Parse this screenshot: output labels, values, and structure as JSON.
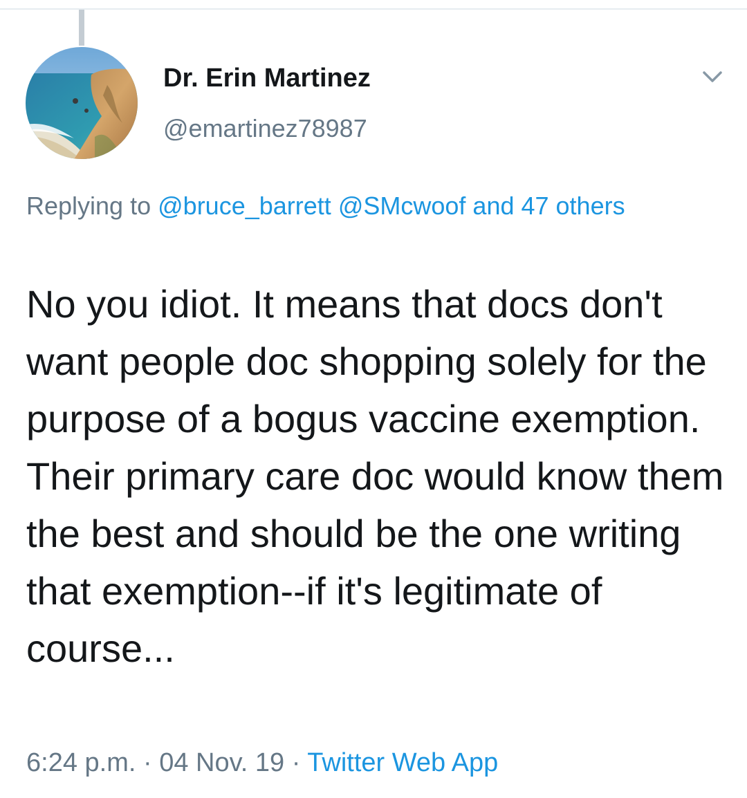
{
  "tweet": {
    "author": {
      "display_name": "Dr. Erin Martinez",
      "handle": "@emartinez78987",
      "avatar_icon": "beach-coast-avatar"
    },
    "menu_icon": "chevron-down-icon",
    "reply_context": {
      "prefix": "Replying to",
      "mention_1": "@bruce_barrett",
      "mention_2": "@SMcwoof",
      "and_others": "and 47 others"
    },
    "text": "No you idiot. It means that docs don't want people doc shopping solely for the purpose of a bogus vaccine exemption. Their primary care doc would know them the best and should be the one writing that exemption--if it's legitimate of course...",
    "time": "6:24 p.m.",
    "date": "04 Nov. 19",
    "separator": "·",
    "source": "Twitter Web App"
  },
  "colors": {
    "text_primary": "#14171a",
    "text_secondary": "#657786",
    "link": "#1b95e0",
    "divider": "#e6ecf0"
  }
}
